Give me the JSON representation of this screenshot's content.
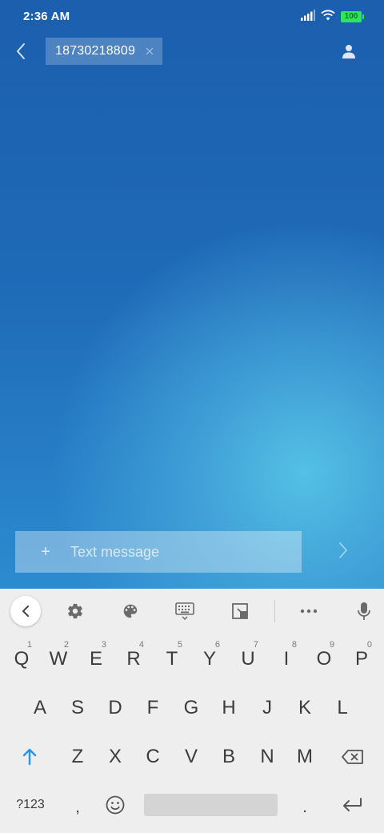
{
  "status": {
    "time": "2:36 AM",
    "battery": "100",
    "battery_color": "#2ee65c"
  },
  "header": {
    "back_icon": "chevron-left-icon",
    "recipient": "18730218809",
    "contact_icon": "person-icon"
  },
  "compose": {
    "attach_symbol": "+",
    "placeholder": "Text message",
    "value": "",
    "send_icon": "chevron-right-icon"
  },
  "keyboard": {
    "toolbar": [
      "collapse-icon",
      "gear-icon",
      "palette-icon",
      "keyboard-icon",
      "resize-icon",
      "more-icon",
      "microphone-icon"
    ],
    "row1": [
      {
        "label": "Q",
        "hint": "1"
      },
      {
        "label": "W",
        "hint": "2"
      },
      {
        "label": "E",
        "hint": "3"
      },
      {
        "label": "R",
        "hint": "4"
      },
      {
        "label": "T",
        "hint": "5"
      },
      {
        "label": "Y",
        "hint": "6"
      },
      {
        "label": "U",
        "hint": "7"
      },
      {
        "label": "I",
        "hint": "8"
      },
      {
        "label": "O",
        "hint": "9"
      },
      {
        "label": "P",
        "hint": "0"
      }
    ],
    "row2": [
      "A",
      "S",
      "D",
      "F",
      "G",
      "H",
      "J",
      "K",
      "L"
    ],
    "row3": [
      "Z",
      "X",
      "C",
      "V",
      "B",
      "N",
      "M"
    ],
    "row4": {
      "symbols": "?123",
      "comma": ",",
      "period": "."
    },
    "accent_color": "#2196f3"
  }
}
